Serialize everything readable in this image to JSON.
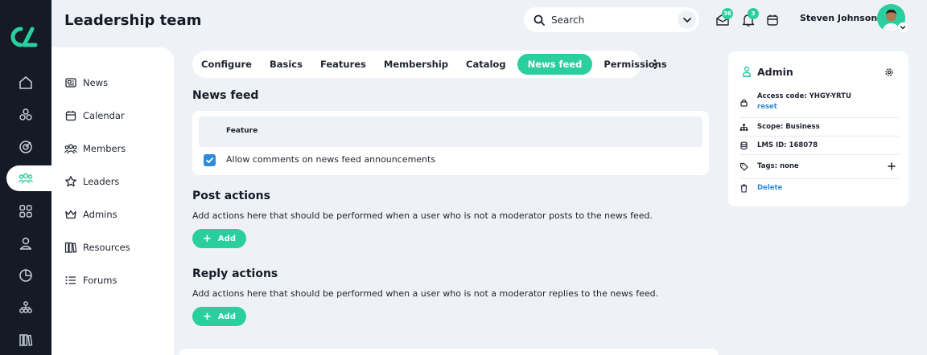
{
  "header": {
    "title": "Leadership team",
    "search_placeholder": "Search",
    "mail_badge": "36",
    "bell_badge": "3",
    "user_name": "Steven Johnson"
  },
  "rail": {
    "icons": [
      "home-icon",
      "cubes-icon",
      "target-icon",
      "members-icon",
      "grid-icon",
      "user-icon",
      "pie-chart-icon",
      "hierarchy-icon",
      "library-icon"
    ],
    "active": "members-icon"
  },
  "subnav": {
    "items": [
      {
        "label": "News",
        "icon": "news-icon"
      },
      {
        "label": "Calendar",
        "icon": "calendar-icon"
      },
      {
        "label": "Members",
        "icon": "members-icon"
      },
      {
        "label": "Leaders",
        "icon": "star-icon"
      },
      {
        "label": "Admins",
        "icon": "crown-icon"
      },
      {
        "label": "Resources",
        "icon": "books-icon"
      },
      {
        "label": "Forums",
        "icon": "list-icon"
      }
    ]
  },
  "tabs": {
    "items": [
      "Configure",
      "Basics",
      "Features",
      "Membership",
      "Catalog",
      "News feed",
      "Permissions"
    ],
    "active": "News feed"
  },
  "news_feed": {
    "heading": "News feed",
    "column_header": "Feature",
    "row_label": "Allow comments on news feed announcements",
    "checked": true
  },
  "post_actions": {
    "heading": "Post actions",
    "description": "Add actions here that should be performed when a user who is not a moderator posts to the news feed.",
    "button": "Add"
  },
  "reply_actions": {
    "heading": "Reply actions",
    "description": "Add actions here that should be performed when a user who is not a moderator replies to the news feed.",
    "button": "Add"
  },
  "admin_panel": {
    "title": "Admin",
    "access_code_label": "Access code: YHGY-YRTU",
    "reset_label": "reset",
    "scope_label": "Scope: Business",
    "lms_label": "LMS ID: 168078",
    "tags_label": "Tags: none",
    "delete_label": "Delete"
  },
  "colors": {
    "accent": "#2bcf9f",
    "rail": "#151b26",
    "link": "#2f8bd8",
    "background": "#eef1f5"
  }
}
